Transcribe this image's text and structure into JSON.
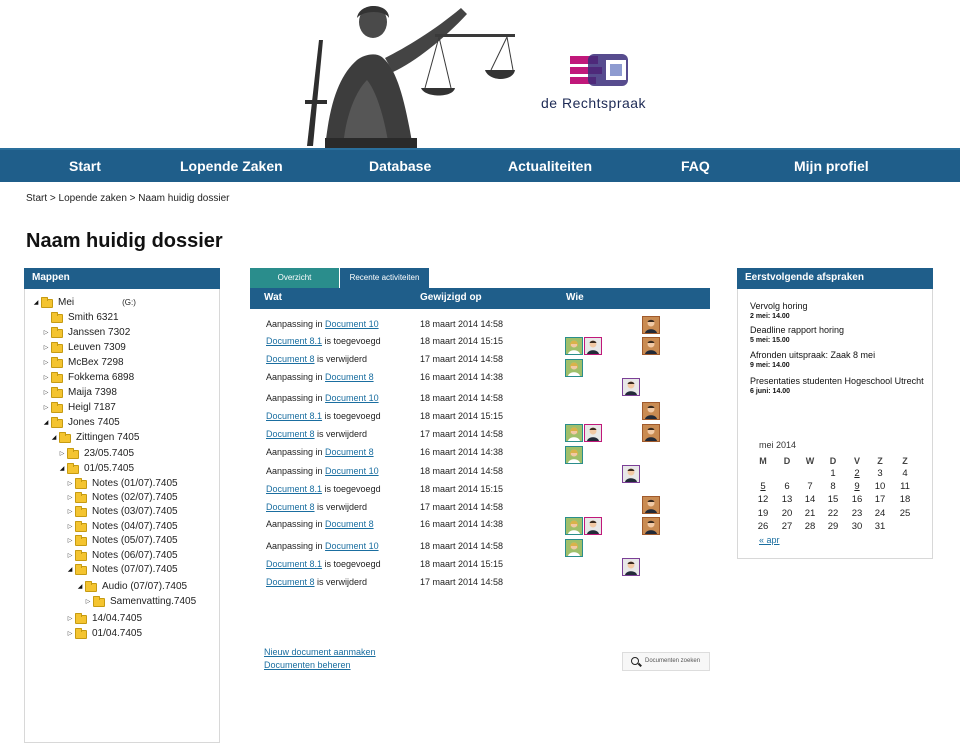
{
  "brand": {
    "logo_text": "de Rechtspraak",
    "color": "#1f5e8a"
  },
  "nav": [
    "Start",
    "Lopende Zaken",
    "Database",
    "Actualiteiten",
    "FAQ",
    "Mijn profiel"
  ],
  "breadcrumb": "Start > Lopende zaken > Naam huidig dossier",
  "page_title": "Naam huidig dossier",
  "folders": {
    "title": "Mappen",
    "tree": [
      {
        "label": "Mei",
        "extra": "(G:)",
        "open": true
      },
      {
        "label": "Smith 6321",
        "toggle": false
      },
      {
        "label": "Janssen 7302",
        "open": false
      },
      {
        "label": "Leuven 7309",
        "open": false
      },
      {
        "label": "McBex 7298",
        "open": false
      },
      {
        "label": "Fokkema 6898",
        "open": false
      },
      {
        "label": "Maija 7398",
        "open": false
      },
      {
        "label": "Heigl 7187",
        "open": false
      },
      {
        "label": "Jones 7405",
        "open": true
      },
      {
        "label": "Zittingen 7405",
        "open": true
      },
      {
        "label": "23/05.7405",
        "open": false
      },
      {
        "label": "01/05.7405",
        "open": true
      },
      {
        "label": "Notes (01/07).7405",
        "open": false
      },
      {
        "label": "Notes (02/07).7405",
        "open": false
      },
      {
        "label": "Notes (03/07).7405",
        "open": false
      },
      {
        "label": "Notes (04/07).7405",
        "open": false
      },
      {
        "label": "Notes (05/07).7405",
        "open": false
      },
      {
        "label": "Notes (06/07).7405",
        "open": false
      },
      {
        "label": "Notes (07/07).7405",
        "open": true
      },
      {
        "label": "Audio (07/07).7405",
        "open": true
      },
      {
        "label": "Samenvatting.7405",
        "open": false
      },
      {
        "label": "14/04.7405",
        "open": false
      },
      {
        "label": "01/04.7405",
        "open": false
      }
    ]
  },
  "tabs": [
    {
      "label": "Overzicht",
      "active": true
    },
    {
      "label": "Recente activiteiten",
      "active": false
    }
  ],
  "table": {
    "headers": [
      "Wat",
      "Gewijzigd op",
      "Wie"
    ],
    "rows": [
      {
        "pre": "Aanpassing in ",
        "link": "Document 10",
        "post": "",
        "date": "18 maart 2014 14:58"
      },
      {
        "pre": "",
        "link": "Document 8.1",
        "post": " is toegevoegd",
        "date": "18 maart 2014 15:15"
      },
      {
        "pre": "",
        "link": "Document 8",
        "post": " is verwijderd",
        "date": "17 maart 2014 14:58"
      },
      {
        "pre": "Aanpassing in ",
        "link": "Document 8",
        "post": "",
        "date": "16 maart 2014 14:38"
      },
      {
        "pre": "Aanpassing in ",
        "link": "Document 10",
        "post": "",
        "date": "18 maart 2014 14:58"
      },
      {
        "pre": "",
        "link": "Document 8.1",
        "post": " is toegevoegd",
        "date": "18 maart 2014 15:15"
      },
      {
        "pre": "",
        "link": "Document 8",
        "post": " is verwijderd",
        "date": "17 maart 2014 14:58"
      },
      {
        "pre": "Aanpassing in ",
        "link": "Document 8",
        "post": "",
        "date": "16 maart 2014 14:38"
      },
      {
        "pre": "Aanpassing in ",
        "link": "Document 10",
        "post": "",
        "date": "18 maart 2014 14:58"
      },
      {
        "pre": "",
        "link": "Document 8.1",
        "post": " is toegevoegd",
        "date": "18 maart 2014 15:15"
      },
      {
        "pre": "",
        "link": "Document 8",
        "post": " is verwijderd",
        "date": "17 maart 2014 14:58"
      },
      {
        "pre": "Aanpassing in ",
        "link": "Document 8",
        "post": "",
        "date": "16 maart 2014 14:38"
      },
      {
        "pre": "Aanpassing in ",
        "link": "Document 10",
        "post": "",
        "date": "18 maart 2014 14:58"
      },
      {
        "pre": "",
        "link": "Document 8.1",
        "post": " is toegevoegd",
        "date": "18 maart 2014 15:15"
      },
      {
        "pre": "",
        "link": "Document 8",
        "post": " is verwijderd",
        "date": "17 maart 2014 14:58"
      }
    ],
    "actions": [
      "Nieuw document aanmaken",
      "Documenten beheren"
    ],
    "search_placeholder": "Documenten zoeken"
  },
  "appointments": {
    "title": "Eerstvolgende afspraken",
    "items": [
      {
        "title": "Vervolg horing",
        "date": "2 mei:  14.00"
      },
      {
        "title": "Deadline rapport horing",
        "date": "5 mei:  15.00"
      },
      {
        "title": "Afronden uitspraak: Zaak 8 mei",
        "date": "9 mei:  14.00"
      },
      {
        "title": "Presentaties studenten Hogeschool Utrecht",
        "date": "6 juni:  14.00"
      }
    ]
  },
  "calendar": {
    "month": "mei 2014",
    "days": [
      "M",
      "D",
      "W",
      "D",
      "V",
      "Z",
      "Z"
    ],
    "weeks": [
      [
        "",
        "",
        "",
        "1",
        "2",
        "3",
        "4"
      ],
      [
        "5",
        "6",
        "7",
        "8",
        "9",
        "10",
        "11"
      ],
      [
        "12",
        "13",
        "14",
        "15",
        "16",
        "17",
        "18"
      ],
      [
        "19",
        "20",
        "21",
        "22",
        "23",
        "24",
        "25"
      ],
      [
        "26",
        "27",
        "28",
        "29",
        "30",
        "31",
        ""
      ]
    ],
    "linked": [
      "2",
      "5",
      "9"
    ],
    "prev_label": "« apr"
  }
}
